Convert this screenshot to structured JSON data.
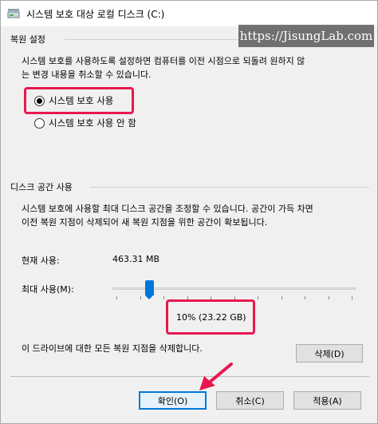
{
  "window": {
    "title": "시스템 보호 대상 로컬 디스크 (C:)"
  },
  "watermark": "https://JisungLab.com",
  "restore_settings": {
    "group_label": "복원 설정",
    "description_line1": "시스템 보호를 사용하도록 설정하면 컴퓨터를 이전 시점으로 되돌려 원하지 않",
    "description_line2": "는 변경 내용을 취소할 수 있습니다.",
    "options": [
      {
        "label": "시스템 보호 사용",
        "checked": true
      },
      {
        "label": "시스템 보호 사용 안 함",
        "checked": false
      }
    ]
  },
  "disk_usage": {
    "group_label": "디스크 공간 사용",
    "description_line1": "시스템 보호에 사용할 최대 디스크 공간을 조정할 수 있습니다. 공간이 가득 차면",
    "description_line2": "이전 복원 지점이 삭제되어 새 복원 지점을 위한 공간이 확보됩니다.",
    "current_label": "현재 사용:",
    "current_value": "463.31 MB",
    "max_label": "최대 사용(M):",
    "slider_fraction": 0.1,
    "max_value": "10% (23.22 GB)",
    "delete_text": "이 드라이브에 대한 모든 복원 지점을 삭제합니다.",
    "delete_button": "삭제(D)"
  },
  "buttons": {
    "ok": "확인(O)",
    "cancel": "취소(C)",
    "apply": "적용(A)"
  },
  "colors": {
    "highlight": "#e8184f",
    "accent": "#0078d7"
  }
}
